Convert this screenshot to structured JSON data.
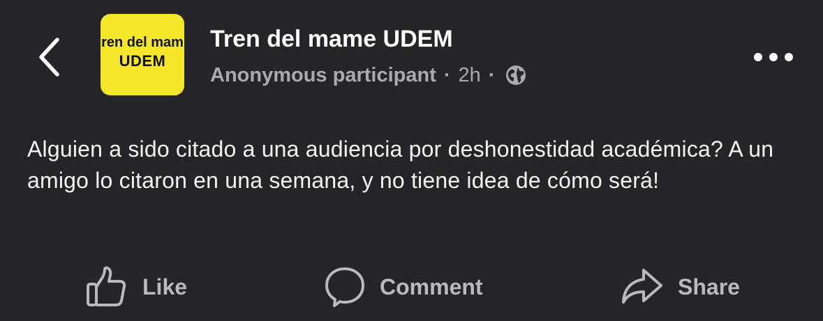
{
  "header": {
    "back_icon": "chevron-left-icon",
    "avatar": {
      "line1": "ren del mam",
      "line2": "UDEM",
      "background": "#f7e72c"
    },
    "group_name": "Tren del mame UDEM",
    "author": "Anonymous participant",
    "separator": "·",
    "time": "2h",
    "visibility_icon": "globe-icon",
    "more_icon": "more-horizontal-icon"
  },
  "post": {
    "text": "Alguien a sido citado a una audiencia por deshonestidad académica? A un amigo lo citaron en una semana, y no tiene idea de cómo será!"
  },
  "actions": {
    "like": {
      "label": "Like",
      "icon": "thumbs-up-icon"
    },
    "comment": {
      "label": "Comment",
      "icon": "comment-bubble-icon"
    },
    "share": {
      "label": "Share",
      "icon": "share-arrow-icon"
    }
  },
  "colors": {
    "background": "#252527",
    "primary_text": "#ffffff",
    "secondary_text": "#a9abb0",
    "action_text": "#b8babe",
    "avatar_yellow": "#f7e72c"
  }
}
